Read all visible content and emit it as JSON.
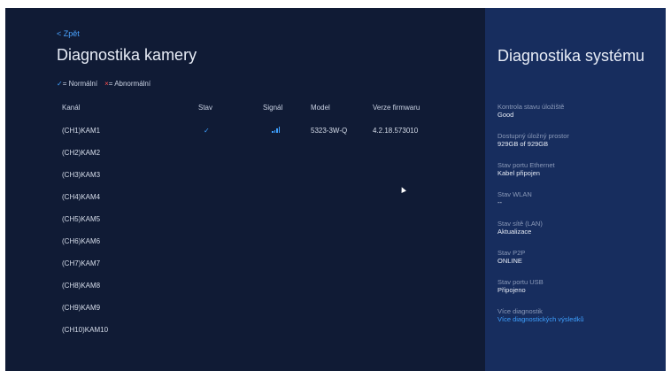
{
  "camera": {
    "back": "< Zpět",
    "title": "Diagnostika kamery",
    "legend": {
      "normal_mark": "✓",
      "normal_label": "= Normální",
      "abnormal_mark": "×",
      "abnormal_label": "= Abnormální"
    },
    "columns": [
      "Kanál",
      "Stav",
      "Signál",
      "Model",
      "Verze firmwaru"
    ],
    "rows": [
      {
        "channel": "(CH1)KAM1",
        "status": "✓",
        "signal": "signal-bars-icon",
        "model": "5323-3W-Q",
        "firmware": "4.2.18.573010"
      },
      {
        "channel": "(CH2)KAM2",
        "status": "",
        "signal": "",
        "model": "",
        "firmware": ""
      },
      {
        "channel": "(CH3)KAM3",
        "status": "",
        "signal": "",
        "model": "",
        "firmware": ""
      },
      {
        "channel": "(CH4)KAM4",
        "status": "",
        "signal": "",
        "model": "",
        "firmware": ""
      },
      {
        "channel": "(CH5)KAM5",
        "status": "",
        "signal": "",
        "model": "",
        "firmware": ""
      },
      {
        "channel": "(CH6)KAM6",
        "status": "",
        "signal": "",
        "model": "",
        "firmware": ""
      },
      {
        "channel": "(CH7)KAM7",
        "status": "",
        "signal": "",
        "model": "",
        "firmware": ""
      },
      {
        "channel": "(CH8)KAM8",
        "status": "",
        "signal": "",
        "model": "",
        "firmware": ""
      },
      {
        "channel": "(CH9)KAM9",
        "status": "",
        "signal": "",
        "model": "",
        "firmware": ""
      },
      {
        "channel": "(CH10)KAM10",
        "status": "",
        "signal": "",
        "model": "",
        "firmware": ""
      }
    ]
  },
  "system": {
    "title": "Diagnostika systému",
    "items": [
      {
        "label": "Kontrola stavu úložiště",
        "value": "Good"
      },
      {
        "label": "Dostupný úložný prostor",
        "value": "929GB of 929GB"
      },
      {
        "label": "Stav portu Ethernet",
        "value": "Kabel připojen"
      },
      {
        "label": "Stav WLAN",
        "value": "--"
      },
      {
        "label": "Stav sítě (LAN)",
        "value": "Aktualizace"
      },
      {
        "label": "Stav P2P",
        "value": "ONLINE"
      },
      {
        "label": "Stav portu USB",
        "value": "Připojeno"
      },
      {
        "label": "Více diagnostik",
        "value": "Více diagnostických výsledků",
        "link": true
      }
    ]
  },
  "colors": {
    "accent": "#3ea0ff",
    "abnormal": "#ff4d4d",
    "background_left": "#101b35",
    "background_right": "#172d5e"
  }
}
